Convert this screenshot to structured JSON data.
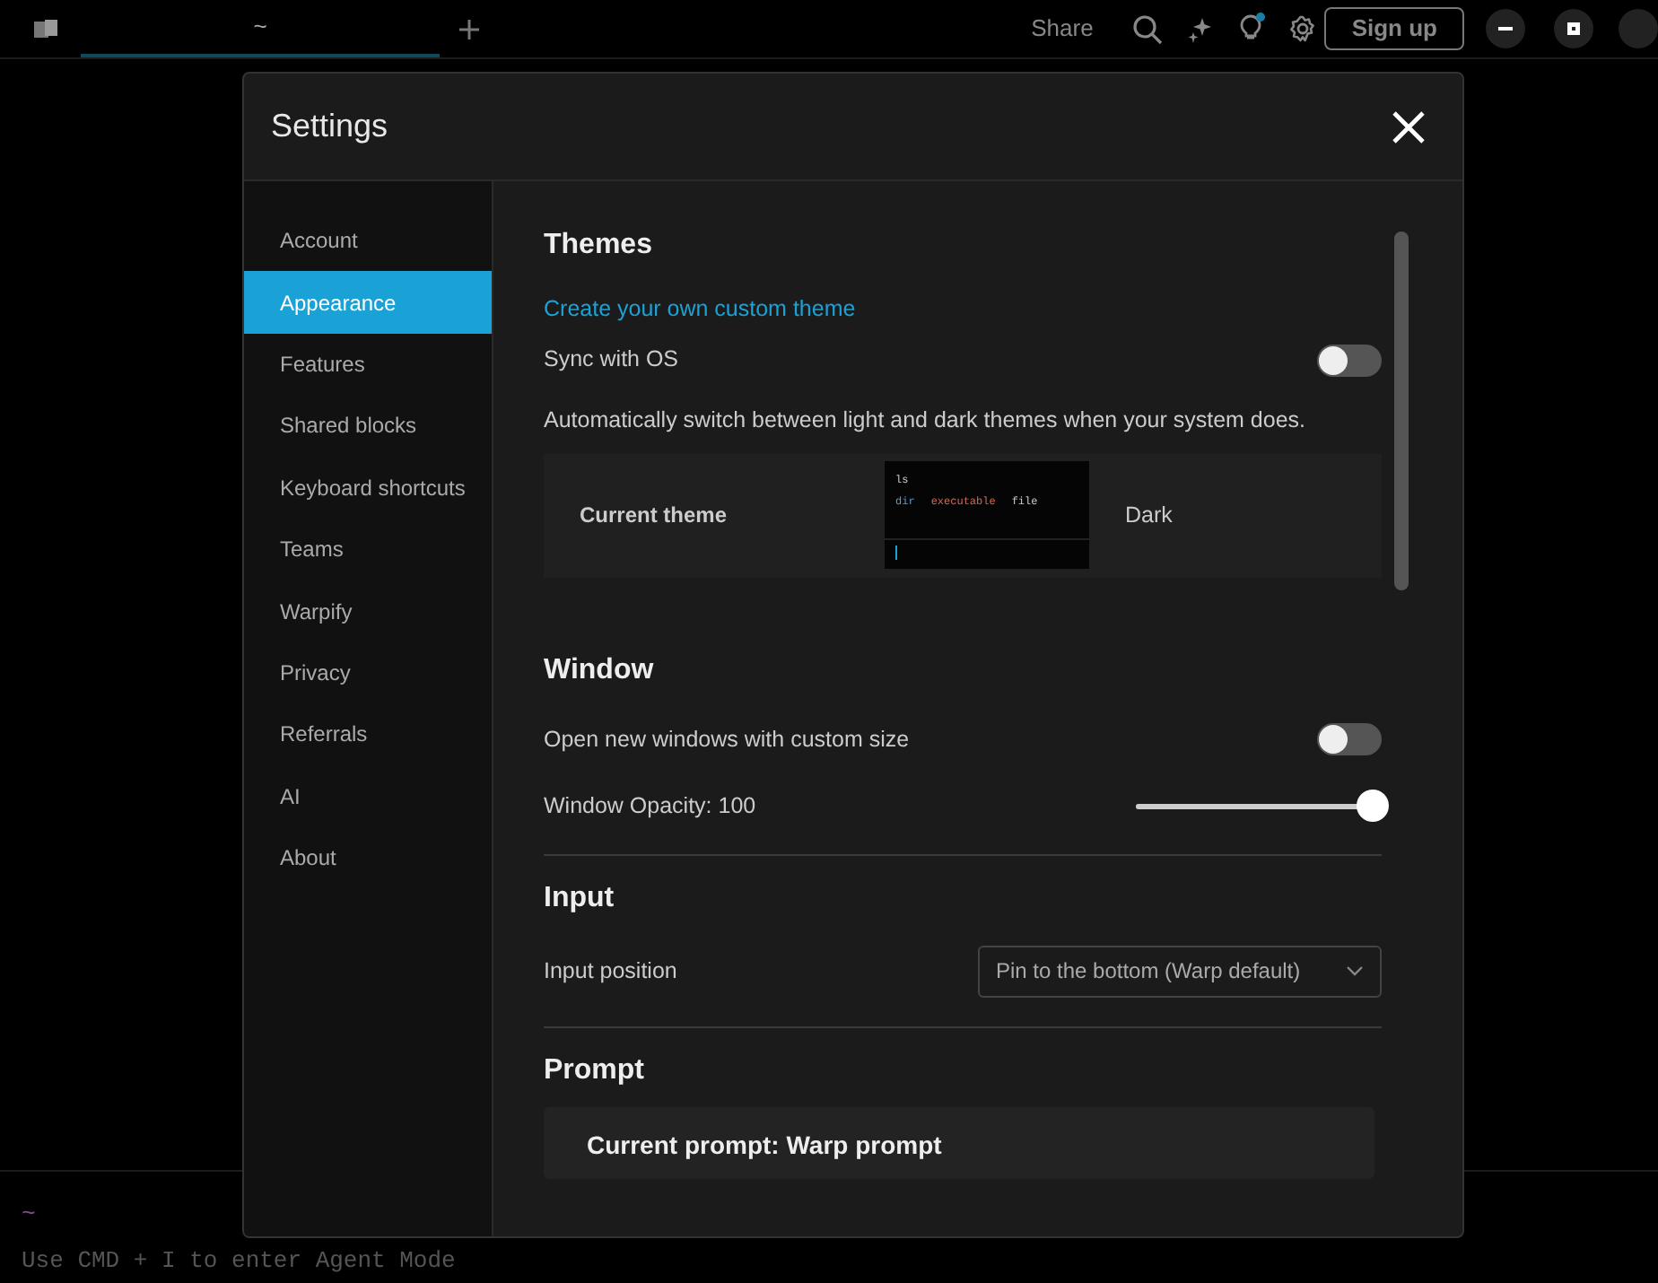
{
  "topbar": {
    "tab_title": "~",
    "share": "Share",
    "sign_up": "Sign up"
  },
  "terminal": {
    "prompt": "~",
    "hint": "Use CMD + I to enter Agent Mode"
  },
  "settings": {
    "title": "Settings",
    "nav": [
      {
        "label": "Account",
        "selected": false
      },
      {
        "label": "Appearance",
        "selected": true
      },
      {
        "label": "Features",
        "selected": false
      },
      {
        "label": "Shared blocks",
        "selected": false
      },
      {
        "label": "Keyboard shortcuts",
        "selected": false
      },
      {
        "label": "Teams",
        "selected": false
      },
      {
        "label": "Warpify",
        "selected": false
      },
      {
        "label": "Privacy",
        "selected": false
      },
      {
        "label": "Referrals",
        "selected": false
      },
      {
        "label": "AI",
        "selected": false
      },
      {
        "label": "About",
        "selected": false
      }
    ],
    "themes": {
      "heading": "Themes",
      "link": "Create your own custom theme",
      "sync_label": "Sync with OS",
      "sync_on": false,
      "description": "Automatically switch between light and dark themes when your system does.",
      "current_label": "Current theme",
      "preview": {
        "command": "ls",
        "entries": [
          "dir",
          "executable",
          "file"
        ]
      },
      "current_value": "Dark"
    },
    "window": {
      "heading": "Window",
      "custom_size_label": "Open new windows with custom size",
      "custom_size_on": false,
      "opacity": {
        "label": "Window Opacity: 100",
        "level": 1.0
      }
    },
    "input": {
      "heading": "Input",
      "position_label": "Input position",
      "position_value": "Pin to the bottom (Warp default)"
    },
    "prompt": {
      "heading": "Prompt",
      "current": "Current prompt: Warp prompt"
    }
  }
}
